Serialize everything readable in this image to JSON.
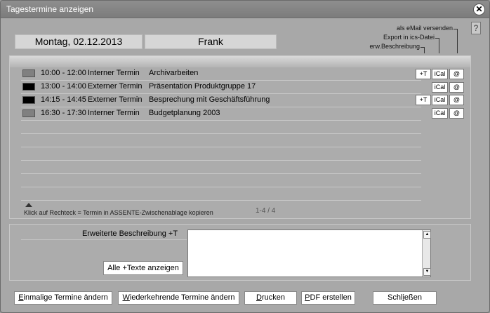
{
  "window": {
    "title": "Tagestermine anzeigen",
    "close_glyph": "✕"
  },
  "header": {
    "date": "Montag, 02.12.2013",
    "user": "Frank",
    "help_glyph": "?"
  },
  "legend": {
    "email": "als eMail versenden",
    "export": "Export in ics-Datei",
    "desc": "erw.Beschreibung"
  },
  "appointments": [
    {
      "time": "10:00 - 12:00",
      "type": "Interner Termin",
      "subject": "Archivarbeiten",
      "color": "#808080",
      "plus_t": "+T",
      "ical": "iCal",
      "email": "@"
    },
    {
      "time": "13:00 - 14:00",
      "type": "Externer Termin",
      "subject": "Präsentation Produktgruppe 17",
      "color": "#000000",
      "plus_t": "",
      "ical": "iCal",
      "email": "@"
    },
    {
      "time": "14:15 - 14:45",
      "type": "Externer Termin",
      "subject": "Besprechung mit Geschäftsführung",
      "color": "#000000",
      "plus_t": "+T",
      "ical": "iCal",
      "email": "@"
    },
    {
      "time": "16:30 - 17:30",
      "type": "Interner Termin",
      "subject": "Budgetplanung 2003",
      "color": "#808080",
      "plus_t": "",
      "ical": "iCal",
      "email": "@"
    }
  ],
  "list": {
    "hint": "Klick auf Rechteck = Termin in ASSENTE-Zwischenablage kopieren",
    "pager": "1-4 / 4"
  },
  "description": {
    "label": "Erweiterte Beschreibung  +T",
    "show_all": "Alle +Texte anzeigen",
    "text": ""
  },
  "buttons": {
    "edit_single_u": "E",
    "edit_single": "inmalige Termine ändern",
    "edit_recurring_u": "W",
    "edit_recurring": "iederkehrende Termine ändern",
    "print_u": "D",
    "print": "rucken",
    "pdf_u": "P",
    "pdf": "DF erstellen",
    "close_pre": "Schl",
    "close_u": "i",
    "close": "eßen"
  }
}
